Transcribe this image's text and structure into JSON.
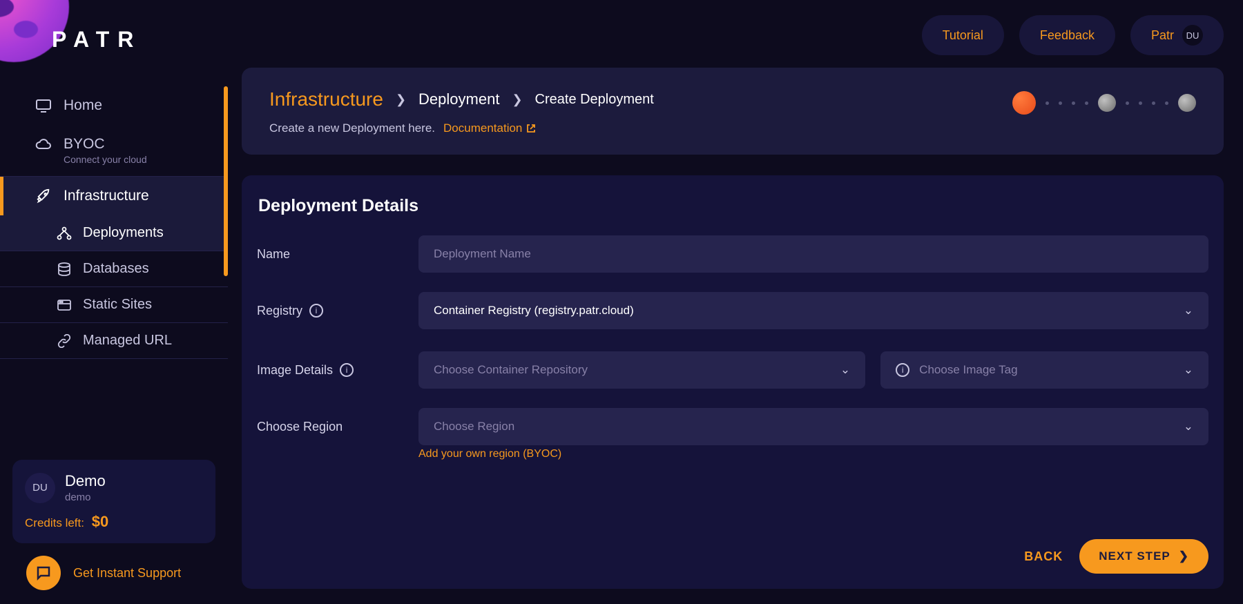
{
  "brand": {
    "name": "PATR"
  },
  "sidebar": {
    "home": "Home",
    "byoc": {
      "label": "BYOC",
      "sub": "Connect your cloud"
    },
    "infrastructure": "Infrastructure",
    "deployments": "Deployments",
    "databases": "Databases",
    "static_sites": "Static Sites",
    "managed_url": "Managed URL"
  },
  "user": {
    "avatar_initials": "DU",
    "name": "Demo",
    "workspace": "demo",
    "credits_label": "Credits left:",
    "credits_amount": "$0"
  },
  "support": {
    "label": "Get Instant Support"
  },
  "topbar": {
    "tutorial": "Tutorial",
    "feedback": "Feedback",
    "workspace": "Patr",
    "avatar": "DU"
  },
  "breadcrumb": {
    "infra": "Infrastructure",
    "deployment": "Deployment",
    "create": "Create Deployment"
  },
  "header": {
    "subtitle": "Create a new Deployment here.",
    "documentation": "Documentation"
  },
  "form": {
    "section_title": "Deployment Details",
    "labels": {
      "name": "Name",
      "registry": "Registry",
      "image_details": "Image Details",
      "choose_region": "Choose Region"
    },
    "placeholders": {
      "name": "Deployment Name",
      "repo": "Choose Container Repository",
      "tag": "Choose Image Tag",
      "region": "Choose Region"
    },
    "registry_value": "Container Registry (registry.patr.cloud)",
    "byoc_link": "Add your own region (BYOC)"
  },
  "footer": {
    "back": "BACK",
    "next": "NEXT STEP"
  }
}
